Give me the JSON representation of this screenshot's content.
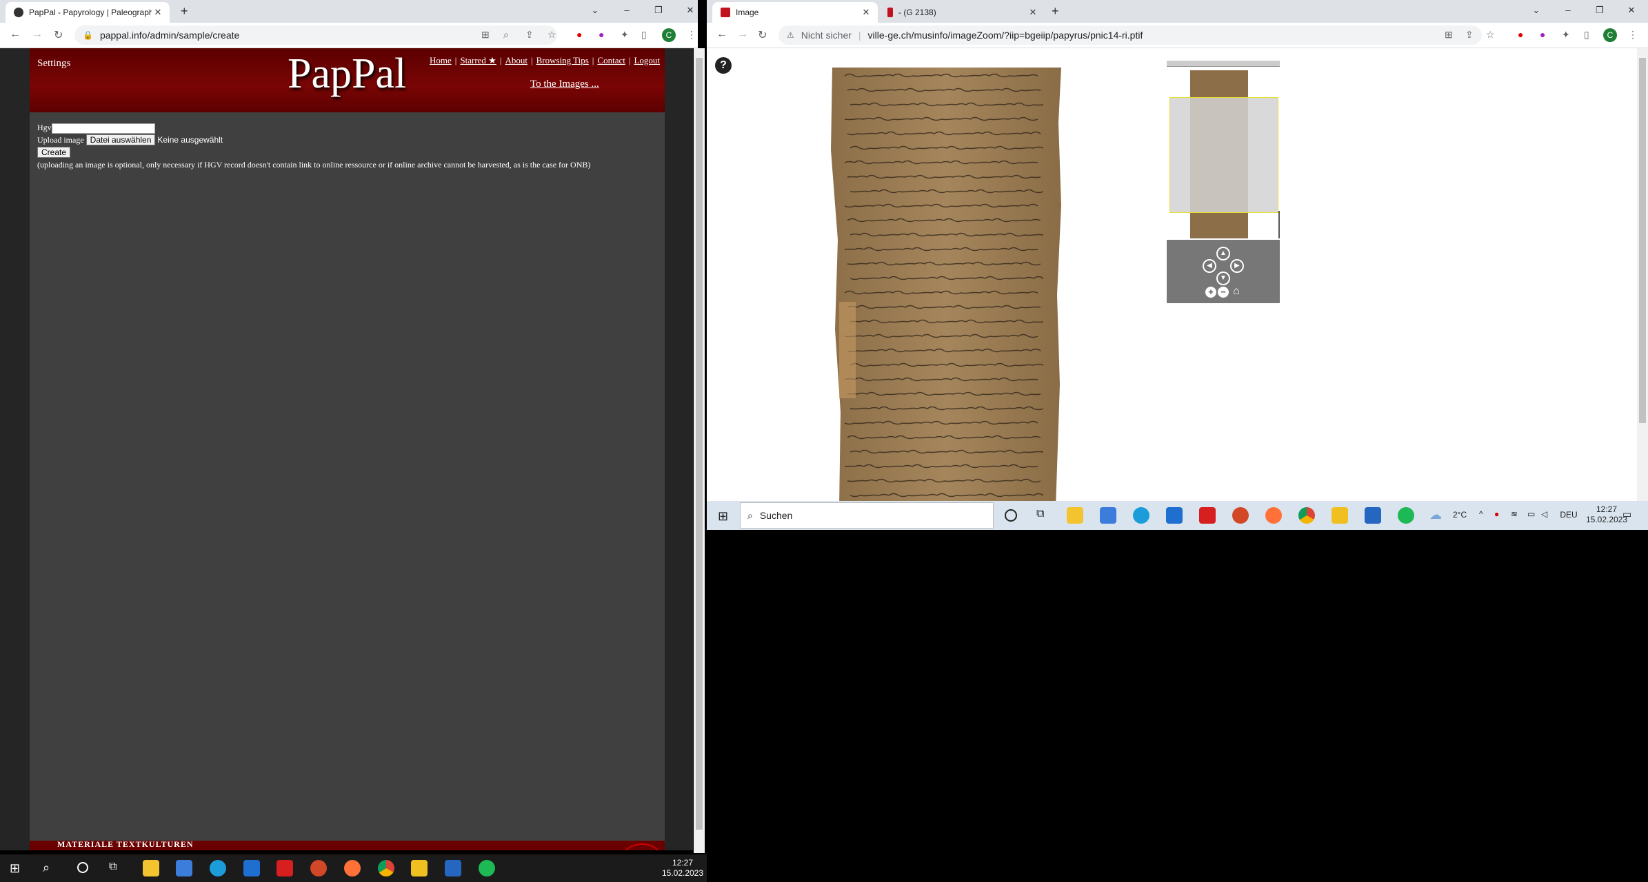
{
  "left_browser": {
    "tab_title": "PapPal - Papyrology | Paleograph",
    "url": "pappal.info/admin/sample/create",
    "window_controls": [
      "⌄",
      "–",
      "❐",
      "✕"
    ]
  },
  "right_browser": {
    "tabs": [
      {
        "title": "Image"
      },
      {
        "title": " - (G 2138)"
      }
    ],
    "security_label": "Nicht sicher",
    "url": "ville-ge.ch/musinfo/imageZoom/?iip=bgeiip/papyrus/pnic14-ri.ptif",
    "window_controls": [
      "⌄",
      "–",
      "❐",
      "✕"
    ]
  },
  "pappal": {
    "settings": "Settings",
    "logo": "PapPal",
    "nav": [
      "Home",
      "Starred ★",
      "About",
      "Browsing Tips",
      "Contact",
      "Logout"
    ],
    "to_images": "To the Images ...",
    "form": {
      "hgv_label": "Hgv",
      "upload_label": "Upload image",
      "file_button": "Datei auswählen",
      "file_status": "Keine ausgewählt",
      "create_button": "Create",
      "note": "(uploading an image is optional, only necessary if HGV record doesn't contain link to online ressource or if online archive cannot be harvested, as is the case for ONB)"
    },
    "footer": "MATERIALE TEXTKULTUREN"
  },
  "viewer": {
    "help": "?",
    "nav_arrows": [
      "▲",
      "◀",
      "▶",
      "▼"
    ],
    "zoom_controls": [
      "+",
      "−",
      "⌂"
    ]
  },
  "taskbar_right": {
    "search_placeholder": "Suchen",
    "weather": "2°C",
    "language": "DEU",
    "time": "12:27",
    "date": "15.02.2023"
  },
  "taskbar_left": {
    "time": "12:27",
    "date": "15.02.2023"
  },
  "colors": {
    "pappal_red": "#6b0000",
    "pappal_bg": "#404040",
    "papyrus": "#a0835c"
  }
}
